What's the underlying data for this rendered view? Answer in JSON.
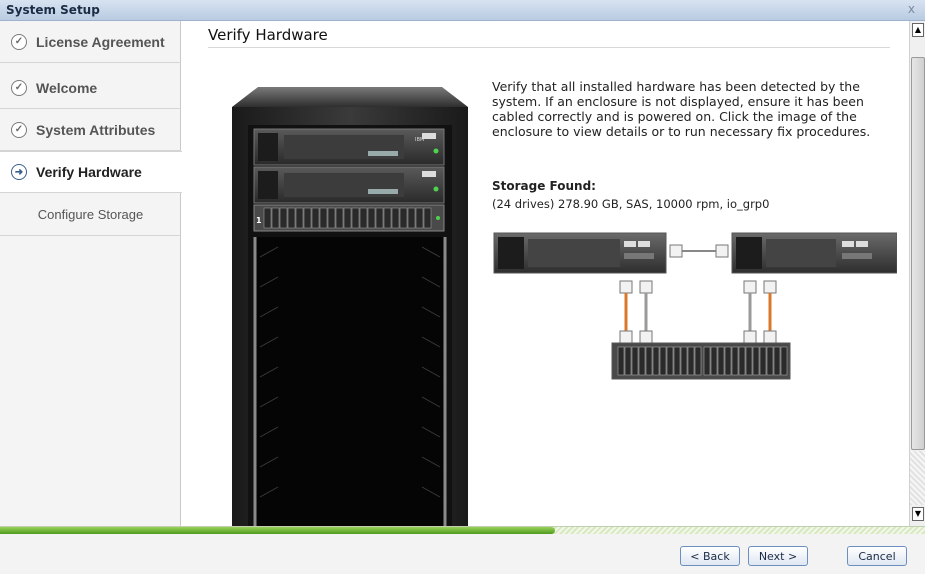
{
  "window": {
    "title": "System Setup",
    "close_glyph": "x"
  },
  "sidebar": {
    "steps": [
      {
        "label": "License Agreement",
        "state": "done",
        "icon": "check-circle-icon",
        "glyph": "✓"
      },
      {
        "label": "Welcome",
        "state": "done",
        "icon": "check-circle-icon",
        "glyph": "✓"
      },
      {
        "label": "System Attributes",
        "state": "done",
        "icon": "check-circle-icon",
        "glyph": "✓"
      },
      {
        "label": "Verify Hardware",
        "state": "current",
        "icon": "arrow-circle-icon",
        "glyph": "➜"
      },
      {
        "label": "Configure Storage",
        "state": "pending"
      }
    ]
  },
  "main": {
    "title": "Verify Hardware",
    "description": "Verify that all installed hardware has been detected by the system. If an enclosure is not displayed, ensure it has been cabled correctly and is powered on. Click the image of the enclosure to view details or to run necessary fix procedures.",
    "storage_found_label": "Storage Found:",
    "storage_found_value": "(24 drives) 278.90 GB, SAS, 10000 rpm, io_grp0",
    "rack": {
      "enclosure_number": "1",
      "badge_text": "IBM"
    }
  },
  "progress": {
    "fraction": 0.6
  },
  "buttons": {
    "back": "< Back",
    "next": "Next >",
    "cancel": "Cancel"
  },
  "colors": {
    "accent": "#4f9a1f",
    "cable": "#d9782d"
  }
}
